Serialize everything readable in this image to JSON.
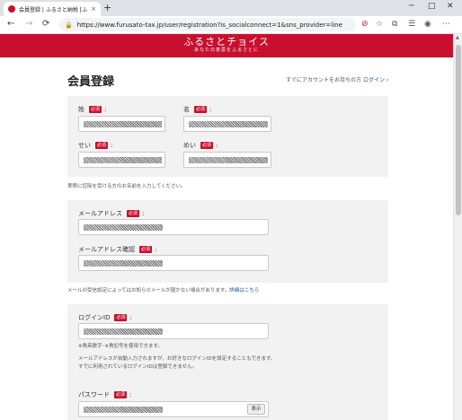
{
  "browser": {
    "tab_title": "会員登録 | ふるさと納税 [ふるさとチ",
    "tab_close": "×",
    "new_tab": "+",
    "url": "https://www.furusato-tax.jp/user/registration?is_socialconnect=1&sns_provider=line",
    "back": "←",
    "forward": "→",
    "reload": "⟳",
    "minimize": "─",
    "maximize": "□",
    "close": "✕"
  },
  "site": {
    "logo": "ふるさとチョイス",
    "tagline": "あなたの意思をふるさとに"
  },
  "page": {
    "title": "会員登録",
    "login_prompt": "すでにアカウントをお持ちの方",
    "login_link": "ログイン ›"
  },
  "required_badge": "必須",
  "name_section": {
    "sei_label": "姓",
    "mei_label": "名",
    "sei_kana_label": "せい",
    "mei_kana_label": "めい",
    "note": "実際に控除を受ける方のお名前を入力してください。"
  },
  "email_section": {
    "email_label": "メールアドレス",
    "email_confirm_label": "メールアドレス確認",
    "note": "メールの受信設定によってはお知らせメールが届かない場合があります。",
    "note_link": "詳細はこちら"
  },
  "login_section": {
    "login_id_label": "ログインID",
    "login_id_note_1": "※角英数字･※角記号を使用できます。",
    "login_id_note_2": "メールアドレスが自動入力されますが、お好きなログインIDを設定することもできます。",
    "login_id_note_3": "すでに利用されているログインIDは登録できません。",
    "password_label": "パスワード",
    "show_button": "表示"
  }
}
